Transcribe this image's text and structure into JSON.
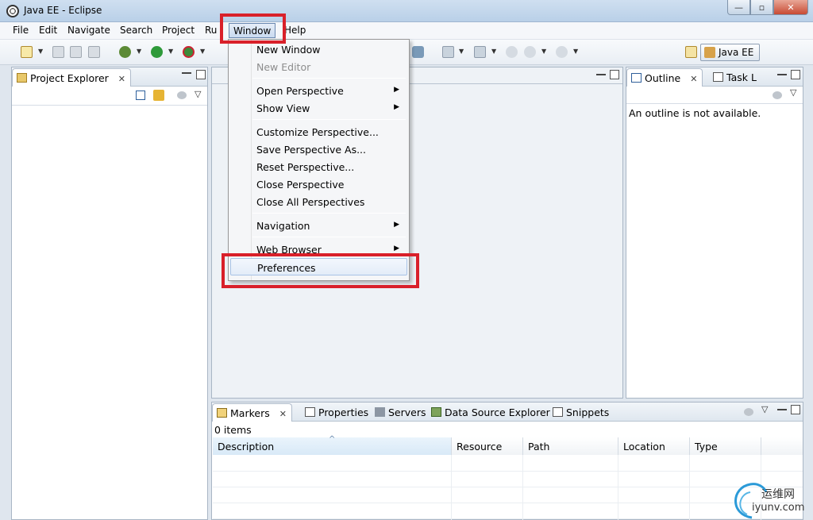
{
  "window": {
    "title": "Java EE - Eclipse",
    "controls": {
      "minimize": "—",
      "maximize": "▫",
      "close": "✕"
    }
  },
  "menubar": {
    "items": [
      "File",
      "Edit",
      "Navigate",
      "Search",
      "Project",
      "Ru",
      "Window",
      "Help"
    ],
    "active": "Window"
  },
  "toolbar": {
    "perspective_label": "Java EE"
  },
  "window_menu": {
    "items": [
      {
        "label": "New Window",
        "enabled": true,
        "submenu": false
      },
      {
        "label": "New Editor",
        "enabled": false,
        "submenu": false
      },
      {
        "label": "Open Perspective",
        "enabled": true,
        "submenu": true
      },
      {
        "label": "Show View",
        "enabled": true,
        "submenu": true
      },
      {
        "label": "Customize Perspective...",
        "enabled": true,
        "submenu": false
      },
      {
        "label": "Save Perspective As...",
        "enabled": true,
        "submenu": false
      },
      {
        "label": "Reset Perspective...",
        "enabled": true,
        "submenu": false
      },
      {
        "label": "Close Perspective",
        "enabled": true,
        "submenu": false
      },
      {
        "label": "Close All Perspectives",
        "enabled": true,
        "submenu": false
      },
      {
        "label": "Navigation",
        "enabled": true,
        "submenu": true
      },
      {
        "label": "Web Browser",
        "enabled": true,
        "submenu": true
      },
      {
        "label": "Preferences",
        "enabled": true,
        "submenu": false,
        "highlighted": true
      }
    ],
    "submenu_arrow": "▶"
  },
  "project_explorer": {
    "tab_label": "Project Explorer",
    "close_glyph": "✕"
  },
  "outline": {
    "tab_label": "Outline",
    "task_tab_label": "Task L",
    "message": "An outline is not available."
  },
  "bottom_panel": {
    "tabs": [
      "Markers",
      "Properties",
      "Servers",
      "Data Source Explorer",
      "Snippets"
    ],
    "item_count": "0 items",
    "columns": [
      "Description",
      "Resource",
      "Path",
      "Location",
      "Type"
    ],
    "sort_indicator": "^"
  },
  "watermark": {
    "cn_text": "运维网",
    "url_text": "iyunv.com"
  },
  "colors": {
    "highlight_box": "#d9202a",
    "accent": "#3a74b8"
  }
}
